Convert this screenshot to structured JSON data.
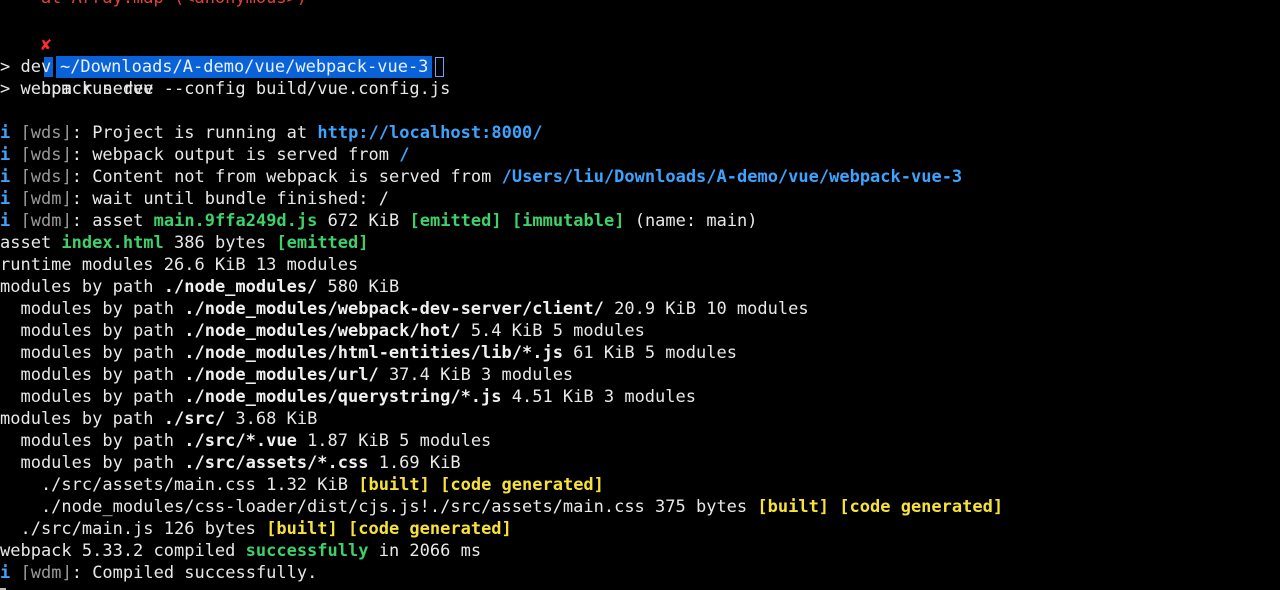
{
  "terminal": {
    "top_partial": "    at Array.map (<anonymous>)",
    "prompt": {
      "status_icon": "✘",
      "path": "~/Downloads/A-demo/vue/webpack-vue-3",
      "command": "npm run dev"
    },
    "script_lines": [
      "> dev",
      "> webpack serve --config build/vue.config.js"
    ],
    "wds_lines": {
      "l1_label": "wds",
      "l1_text": ": Project is running at ",
      "l1_url": "http://localhost:8000/",
      "l2_label": "wds",
      "l2_text": ": webpack output is served from ",
      "l2_path": "/",
      "l3_label": "wds",
      "l3_text": ": Content not from webpack is served from ",
      "l3_path": "/Users/liu/Downloads/A-demo/vue/webpack-vue-3",
      "l4_label": "wdm",
      "l4_text": ": wait until bundle finished: /",
      "l5_label": "wdm",
      "l5_text_a": ": asset ",
      "l5_asset": "main.9ffa249d.js",
      "l5_size": " 672 KiB ",
      "l5_emitted": "[emitted]",
      "l5_immutable": "[immutable]",
      "l5_name": " (name: main)"
    },
    "build": {
      "asset_a": "asset ",
      "asset_file": "index.html",
      "asset_b": " 386 bytes ",
      "asset_emitted": "[emitted]",
      "runtime": "runtime modules 26.6 KiB 13 modules",
      "nm_a": "modules by path ",
      "nm_path": "./node_modules/",
      "nm_b": " 580 KiB",
      "nm_items": [
        {
          "prefix": "  modules by path ",
          "path": "./node_modules/webpack-dev-server/client/",
          "rest": " 20.9 KiB 10 modules"
        },
        {
          "prefix": "  modules by path ",
          "path": "./node_modules/webpack/hot/",
          "rest": " 5.4 KiB 5 modules"
        },
        {
          "prefix": "  modules by path ",
          "path": "./node_modules/html-entities/lib/*.js",
          "rest": " 61 KiB 5 modules"
        },
        {
          "prefix": "  modules by path ",
          "path": "./node_modules/url/",
          "rest": " 37.4 KiB 3 modules"
        },
        {
          "prefix": "  modules by path ",
          "path": "./node_modules/querystring/*.js",
          "rest": " 4.51 KiB 3 modules"
        }
      ],
      "src_a": "modules by path ",
      "src_path": "./src/",
      "src_b": " 3.68 KiB",
      "src_vue_prefix": "  modules by path ",
      "src_vue_path": "./src/*.vue",
      "src_vue_rest": " 1.87 KiB 5 modules",
      "src_css_prefix": "  modules by path ",
      "src_css_path": "./src/assets/*.css",
      "src_css_rest": " 1.69 KiB",
      "main_css": "    ./src/assets/main.css 1.32 KiB ",
      "built": "[built]",
      "code_generated": "[code generated]",
      "loader_css": "    ./node_modules/css-loader/dist/cjs.js!./src/assets/main.css 375 bytes ",
      "main_js": "  ./src/main.js 126 bytes ",
      "compiled_a": "webpack 5.33.2 compiled ",
      "compiled_success": "successfully",
      "compiled_b": " in 2066 ms"
    },
    "final_label": "wdm",
    "final_text": ": Compiled successfully."
  }
}
